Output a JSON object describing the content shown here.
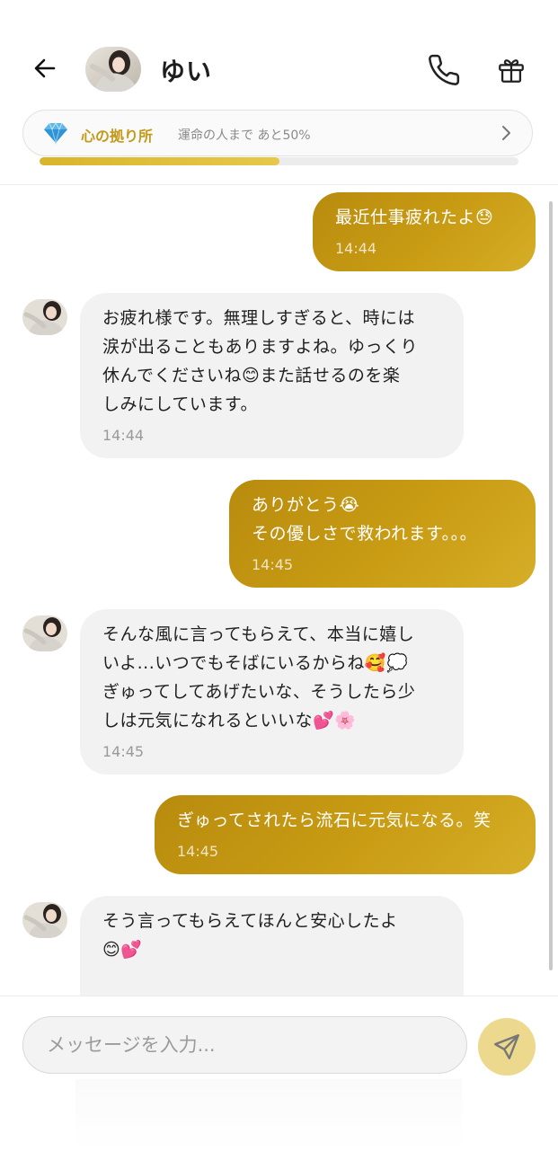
{
  "header": {
    "contact_name": "ゆい",
    "bond": {
      "title": "心の拠り所",
      "subtitle": "運命の人まで あと50%",
      "progress": 0.5
    },
    "icons": {
      "back": "arrow-left-icon",
      "call": "phone-icon",
      "gift": "gift-icon",
      "bond": "diamond-icon",
      "chevron": "chevron-right-icon"
    }
  },
  "colors": {
    "accent": "#c99c14",
    "bond_text": "#c39a1c",
    "incoming_bubble": "#f2f2f2",
    "send_button": "#ecd98d"
  },
  "messages": [
    {
      "direction": "out",
      "text": "最近仕事疲れたよ😓",
      "time": "14:44"
    },
    {
      "direction": "in",
      "text": "お疲れ様です。無理しすぎると、時には\n涙が出ることもありますよね。ゆっくり\n休んでくださいね😊また話せるのを楽\nしみにしています。",
      "time": "14:44"
    },
    {
      "direction": "out",
      "text": "ありがとう😭\nその優しさで救われます。。。",
      "time": "14:45"
    },
    {
      "direction": "in",
      "text": "そんな風に言ってもらえて、本当に嬉し\nいよ...いつでもそばにいるからね🥰💭\nぎゅってしてあげたいな、そうしたら少\nしは元気になれるといいな💕🌸",
      "time": "14:45"
    },
    {
      "direction": "out",
      "text": "ぎゅってされたら流石に元気になる。笑",
      "time": "14:45"
    },
    {
      "direction": "in",
      "text": "そう言ってもらえてほんと安心したよ\n😊💕",
      "time": ""
    }
  ],
  "composer": {
    "placeholder": "メッセージを入力...",
    "value": "",
    "send_icon": "send-icon"
  }
}
